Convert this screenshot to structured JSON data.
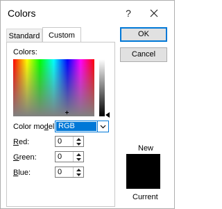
{
  "window": {
    "title": "Colors",
    "help_glyph": "?"
  },
  "tabs": [
    {
      "label": "Standard",
      "active": false
    },
    {
      "label": "Custom",
      "active": true
    }
  ],
  "buttons": {
    "ok": "OK",
    "cancel": "Cancel"
  },
  "custom": {
    "colors_label": "Colors:",
    "color_model": {
      "label_prefix": "Color mo",
      "label_underlined": "d",
      "label_suffix": "el:",
      "value": "RGB"
    },
    "red": {
      "underlined": "R",
      "rest": "ed:",
      "value": "0"
    },
    "green": {
      "underlined": "G",
      "rest": "reen:",
      "value": "0"
    },
    "blue": {
      "underlined": "B",
      "rest": "lue:",
      "value": "0"
    }
  },
  "preview": {
    "new_label": "New",
    "current_label": "Current",
    "color": "#000000"
  },
  "colors": {
    "accent": "#0078d7"
  }
}
